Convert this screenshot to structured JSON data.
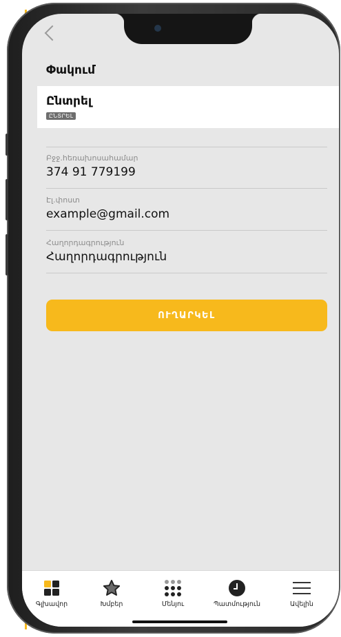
{
  "screen": {
    "title": "Փակում"
  },
  "select": {
    "label": "Ընտրել",
    "badge": "ԸՆՏՐԵԼ"
  },
  "fields": {
    "phone": {
      "label": "Բջջ.հեռախոսահամար",
      "value": "374 91 779199"
    },
    "email": {
      "label": "Էլ.փոստ",
      "value": "example@gmail.com"
    },
    "message": {
      "label": "Հաղորդագրություն",
      "value": "Հաղորդագրություն"
    }
  },
  "send_button": {
    "label": "ՈՒՂԱՐԿԵԼ"
  },
  "nav": {
    "items": [
      {
        "label": "Գլխավոր",
        "icon": "grid-icon"
      },
      {
        "label": "Խմբեր",
        "icon": "star-icon"
      },
      {
        "label": "Մենյու",
        "icon": "dots-grid-icon"
      },
      {
        "label": "Պատմություն",
        "icon": "clock-icon"
      },
      {
        "label": "Ավելին",
        "icon": "hamburger-icon"
      }
    ]
  },
  "colors": {
    "accent": "#f7b91c",
    "screen_bg": "#e7e7e7",
    "text": "#111111"
  }
}
